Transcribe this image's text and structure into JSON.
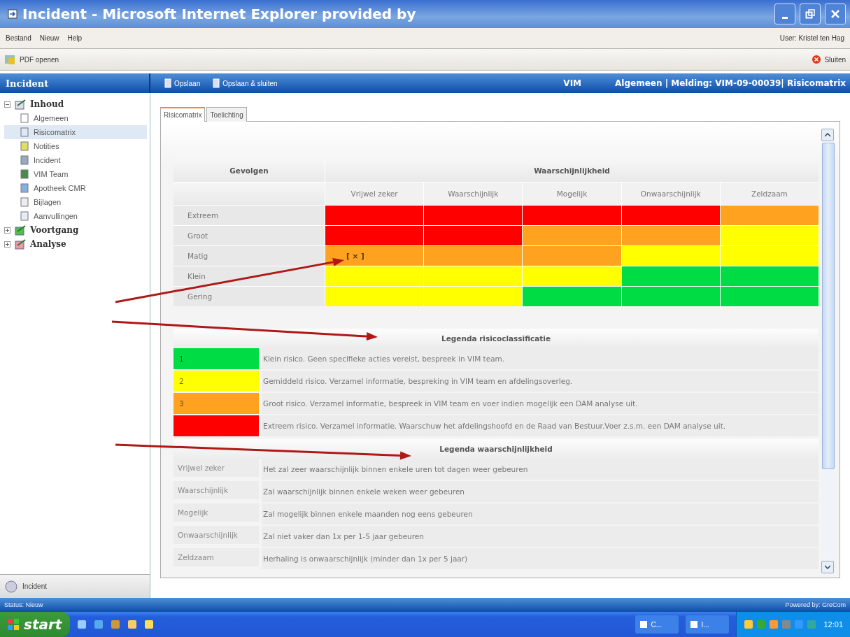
{
  "window": {
    "title": "Incident - Microsoft Internet Explorer provided by"
  },
  "menu": [
    "Bestand",
    "Nieuw",
    "Help"
  ],
  "user": "User: Kristel ten Hag",
  "toolbar": {
    "left": "PDF openen",
    "right": "Sluiten"
  },
  "sidebar": {
    "title": "Incident",
    "footer": "Incident",
    "tree": [
      {
        "label": "Inhoud",
        "expanded": true,
        "children": [
          {
            "label": "Algemeen",
            "selected": false
          },
          {
            "label": "Risicomatrix",
            "selected": true
          },
          {
            "label": "Notities",
            "selected": false
          },
          {
            "label": "Incident",
            "selected": false
          },
          {
            "label": "VIM Team",
            "selected": false
          },
          {
            "label": "Apotheek CMR",
            "selected": false
          },
          {
            "label": "Bijlagen",
            "selected": false
          },
          {
            "label": "Aanvullingen",
            "selected": false
          }
        ]
      },
      {
        "label": "Voortgang",
        "expanded": false
      },
      {
        "label": "Analyse",
        "expanded": false
      }
    ]
  },
  "header": {
    "buttons": [
      "Opslaan",
      "Opslaan & sluiten"
    ],
    "module": "VIM",
    "breadcrumb": "Algemeen | Melding: VIM-09-00039| Risicomatrix"
  },
  "tabs": [
    {
      "label": "Risicomatrix",
      "selected": true
    },
    {
      "label": "Toelichting",
      "selected": false
    }
  ],
  "matrix": {
    "row_header": "Gevolgen",
    "column_group": "Waarschijnlijkheid",
    "columns": [
      "Vrijwel zeker",
      "Waarschijnlijk",
      "Mogelijk",
      "Onwaarschijnlijk",
      "Zeldzaam"
    ],
    "rows": [
      {
        "label": "Extreem",
        "cells": [
          {
            "color": "#ff0000"
          },
          {
            "color": "#ff0000"
          },
          {
            "color": "#ff0000"
          },
          {
            "color": "#ff0000"
          },
          {
            "color": "#ffa21f"
          }
        ]
      },
      {
        "label": "Groot",
        "cells": [
          {
            "color": "#ff0000"
          },
          {
            "color": "#ff0000"
          },
          {
            "color": "#ffa21f"
          },
          {
            "color": "#ffa21f"
          },
          {
            "color": "#ffff00"
          }
        ]
      },
      {
        "label": "Matig",
        "cells": [
          {
            "color": "#ffa21f",
            "mark": "[ × ]"
          },
          {
            "color": "#ffa21f"
          },
          {
            "color": "#ffa21f"
          },
          {
            "color": "#ffff00"
          },
          {
            "color": "#ffff00"
          }
        ]
      },
      {
        "label": "Klein",
        "cells": [
          {
            "color": "#ffff00"
          },
          {
            "color": "#ffff00"
          },
          {
            "color": "#ffff00"
          },
          {
            "color": "#00dd44"
          },
          {
            "color": "#00dd44"
          }
        ]
      },
      {
        "label": "Gering",
        "cells": [
          {
            "color": "#ffff00"
          },
          {
            "color": "#ffff00"
          },
          {
            "color": "#00dd44"
          },
          {
            "color": "#00dd44"
          },
          {
            "color": "#00dd44"
          }
        ]
      }
    ]
  },
  "risk_legend": {
    "title": "Legenda risicoclassificatie",
    "rows": [
      {
        "number": "1",
        "color": "#00dd44",
        "text": "Klein risico. Geen specifieke acties vereist, bespreek in VIM team."
      },
      {
        "number": "2",
        "color": "#ffff00",
        "text": "Gemiddeld risico. Verzamel informatie, bespreking in VIM team en afdelingsoverleg."
      },
      {
        "number": "3",
        "color": "#ffa21f",
        "text": "Groot risico. Verzamel informatie, bespreek in VIM team en voer indien mogelijk een DAM analyse uit."
      },
      {
        "color": "#ff0000",
        "text": "Extreem risico. Verzamel informatie. Waarschuw het afdelingshoofd en de Raad van Bestuur.Voer z.s.m. een DAM analyse uit."
      }
    ]
  },
  "likelihood_legend": {
    "title": "Legenda waarschijnlijkheid",
    "rows": [
      {
        "term": "Vrijwel zeker",
        "text": "Het zal zeer waarschijnlijk binnen enkele uren tot dagen weer gebeuren"
      },
      {
        "term": "Waarschijnlijk",
        "text": "Zal waarschijnlijk binnen enkele weken weer gebeuren"
      },
      {
        "term": "Mogelijk",
        "text": "Zal mogelijk binnen enkele maanden nog eens gebeuren"
      },
      {
        "term": "Onwaarschijnlijk",
        "text": "Zal niet vaker dan 1x per 1-5 jaar gebeuren"
      },
      {
        "term": "Zeldzaam",
        "text": "Herhaling is onwaarschijnlijk (minder dan 1x per 5 jaar)"
      }
    ]
  },
  "status_bar": {
    "left": "Status: Nieuw",
    "right": "Powered by: GreCom"
  },
  "taskbar": {
    "start": "start",
    "tasks": [
      "C...",
      "I..."
    ],
    "clock": "12:01"
  }
}
